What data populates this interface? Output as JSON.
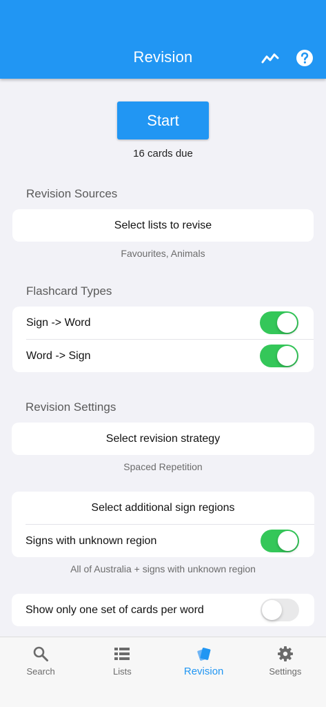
{
  "header": {
    "title": "Revision"
  },
  "start": {
    "label": "Start",
    "due": "16 cards due"
  },
  "sources": {
    "section": "Revision Sources",
    "button": "Select lists to revise",
    "caption": "Favourites, Animals"
  },
  "flashcards": {
    "section": "Flashcard Types",
    "rows": [
      {
        "label": "Sign -> Word",
        "on": true
      },
      {
        "label": "Word -> Sign",
        "on": true
      }
    ]
  },
  "settings": {
    "section": "Revision Settings",
    "strategy_button": "Select revision strategy",
    "strategy_caption": "Spaced Repetition",
    "regions_button": "Select additional sign regions",
    "unknown_region_label": "Signs with unknown region",
    "unknown_region_on": true,
    "regions_caption": "All of Australia + signs with unknown region",
    "one_set_label": "Show only one set of cards per word",
    "one_set_on": false
  },
  "nav": {
    "items": [
      {
        "label": "Search",
        "icon": "search-icon"
      },
      {
        "label": "Lists",
        "icon": "list-icon"
      },
      {
        "label": "Revision",
        "icon": "cards-icon",
        "active": true
      },
      {
        "label": "Settings",
        "icon": "gear-icon"
      }
    ]
  },
  "colors": {
    "primary": "#2196f3",
    "switch_on": "#34c759",
    "background": "#f2f2f7"
  }
}
